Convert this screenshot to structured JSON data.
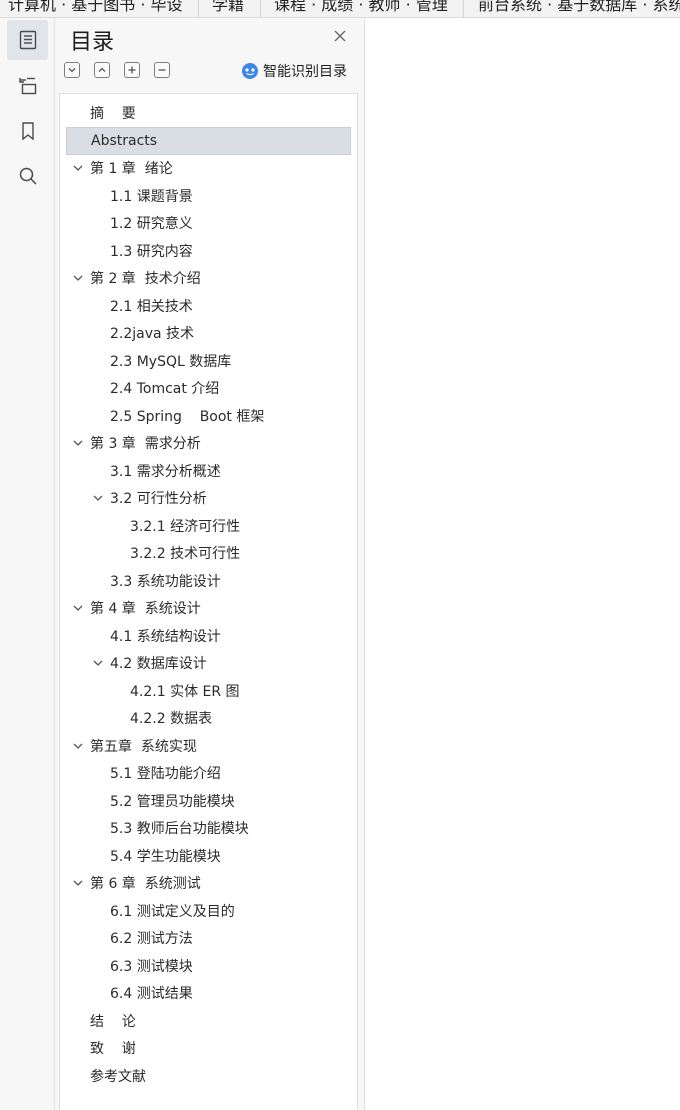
{
  "top_strip": {
    "fragments": [
      "计算机 · 基于图书 · 毕设",
      "学籍",
      "课程 · 成绩 · 教师 · 管理",
      "前台系统 · 基于数据库 · 系统"
    ]
  },
  "rail": {
    "icons": [
      "toc-icon",
      "bookmark-list-icon",
      "bookmark-icon",
      "search-icon"
    ]
  },
  "panel": {
    "title": "目录",
    "smart_label": "智能识别目录",
    "toolbar_icons": [
      "expand-icon",
      "collapse-icon",
      "add-icon",
      "remove-icon"
    ]
  },
  "colors": {
    "selected_bg": "#d9dee5",
    "panel_bg": "#f7f7f7",
    "smart_icon": "#3d87e6",
    "text": "#2b2b2b"
  },
  "toc": [
    {
      "label": "摘    要",
      "level": 0,
      "chevron": false,
      "selected": false
    },
    {
      "label": "Abstracts",
      "level": 0,
      "chevron": false,
      "selected": true
    },
    {
      "label": "第 1 章  绪论",
      "level": 0,
      "chevron": true,
      "selected": false
    },
    {
      "label": "1.1 课题背景",
      "level": 1,
      "chevron": false,
      "selected": false
    },
    {
      "label": "1.2 研究意义",
      "level": 1,
      "chevron": false,
      "selected": false
    },
    {
      "label": "1.3 研究内容",
      "level": 1,
      "chevron": false,
      "selected": false
    },
    {
      "label": "第 2 章  技术介绍",
      "level": 0,
      "chevron": true,
      "selected": false
    },
    {
      "label": "2.1 相关技术",
      "level": 1,
      "chevron": false,
      "selected": false
    },
    {
      "label": "2.2java 技术",
      "level": 1,
      "chevron": false,
      "selected": false
    },
    {
      "label": "2.3 MySQL 数据库",
      "level": 1,
      "chevron": false,
      "selected": false
    },
    {
      "label": "2.4 Tomcat 介绍",
      "level": 1,
      "chevron": false,
      "selected": false
    },
    {
      "label": "2.5 Spring    Boot 框架",
      "level": 1,
      "chevron": false,
      "selected": false
    },
    {
      "label": "第 3 章  需求分析",
      "level": 0,
      "chevron": true,
      "selected": false
    },
    {
      "label": "3.1 需求分析概述",
      "level": 1,
      "chevron": false,
      "selected": false
    },
    {
      "label": "3.2 可行性分析",
      "level": 1,
      "chevron": true,
      "selected": false
    },
    {
      "label": "3.2.1 经济可行性",
      "level": 2,
      "chevron": false,
      "selected": false
    },
    {
      "label": "3.2.2 技术可行性",
      "level": 2,
      "chevron": false,
      "selected": false
    },
    {
      "label": "3.3 系统功能设计",
      "level": 1,
      "chevron": false,
      "selected": false
    },
    {
      "label": "第 4 章  系统设计",
      "level": 0,
      "chevron": true,
      "selected": false
    },
    {
      "label": "4.1 系统结构设计",
      "level": 1,
      "chevron": false,
      "selected": false
    },
    {
      "label": "4.2 数据库设计",
      "level": 1,
      "chevron": true,
      "selected": false
    },
    {
      "label": "4.2.1 实体 ER 图",
      "level": 2,
      "chevron": false,
      "selected": false
    },
    {
      "label": "4.2.2 数据表",
      "level": 2,
      "chevron": false,
      "selected": false
    },
    {
      "label": "第五章  系统实现",
      "level": 0,
      "chevron": true,
      "selected": false
    },
    {
      "label": "5.1 登陆功能介绍",
      "level": 1,
      "chevron": false,
      "selected": false
    },
    {
      "label": "5.2 管理员功能模块",
      "level": 1,
      "chevron": false,
      "selected": false
    },
    {
      "label": "5.3 教师后台功能模块",
      "level": 1,
      "chevron": false,
      "selected": false
    },
    {
      "label": "5.4 学生功能模块",
      "level": 1,
      "chevron": false,
      "selected": false
    },
    {
      "label": "第 6 章  系统测试",
      "level": 0,
      "chevron": true,
      "selected": false
    },
    {
      "label": "6.1 测试定义及目的",
      "level": 1,
      "chevron": false,
      "selected": false
    },
    {
      "label": "6.2 测试方法",
      "level": 1,
      "chevron": false,
      "selected": false
    },
    {
      "label": "6.3 测试模块",
      "level": 1,
      "chevron": false,
      "selected": false
    },
    {
      "label": "6.4 测试结果",
      "level": 1,
      "chevron": false,
      "selected": false
    },
    {
      "label": "结    论",
      "level": 0,
      "chevron": false,
      "selected": false
    },
    {
      "label": "致    谢",
      "level": 0,
      "chevron": false,
      "selected": false
    },
    {
      "label": "参考文献",
      "level": 0,
      "chevron": false,
      "selected": false
    }
  ]
}
